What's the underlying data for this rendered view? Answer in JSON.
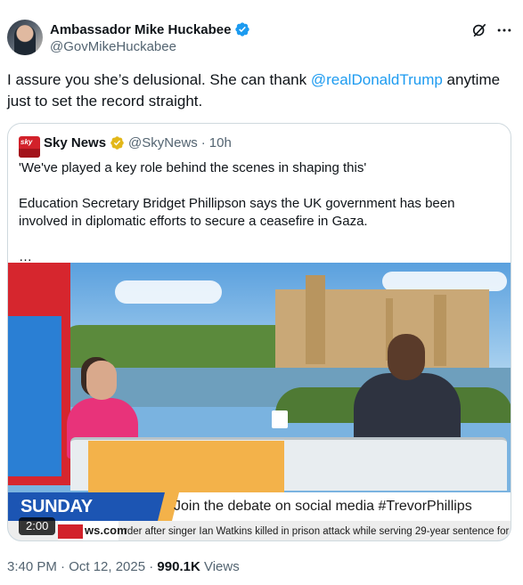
{
  "author": {
    "display_name": "Ambassador Mike Huckabee",
    "handle": "@GovMikeHuckabee",
    "verified_color": "#1d9bf0"
  },
  "icons": {
    "verified": "verified-badge-icon",
    "grok": "grok-icon",
    "more": "more-options-icon"
  },
  "tweet": {
    "text_before": "I assure you she’s delusional.  She can thank ",
    "mention": "@realDonaldTrump",
    "text_after": " anytime just to set the record straight."
  },
  "quote": {
    "display_name": "Sky News",
    "handle": "@SkyNews",
    "separator": "·",
    "time": "10h",
    "verified_color": "#e2b719",
    "line1": "'We've played a key role behind the scenes in shaping this'",
    "line2": "Education Secretary Bridget Phillipson says the UK government has been involved in diplomatic efforts to secure a ceasefire in Gaza.",
    "ellipsis": "…",
    "logo_text": "sky",
    "video": {
      "duration": "2:00",
      "banner_tag": "SUNDAY MORNING",
      "banner_text": "Join the debate on social media #TrevorPhillips",
      "ticker_site": "ws.com",
      "ticker_text": "rder after singer Ian Watkins killed in prison attack while serving 29-year sentence for chi"
    }
  },
  "meta": {
    "time": "3:40 PM · Oct 12, 2025 · ",
    "views_count": "990.1K",
    "views_label": " Views"
  },
  "colors": {
    "link": "#1d9bf0",
    "secondary_text": "#536471",
    "primary_text": "#0f1419",
    "border": "#cfd9de"
  }
}
